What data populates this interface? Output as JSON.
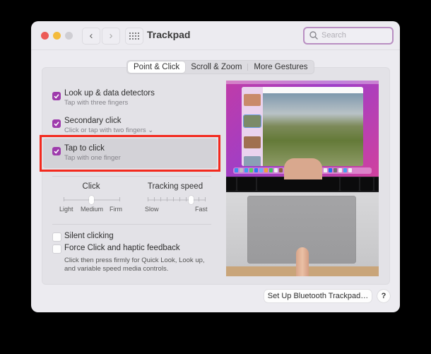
{
  "window": {
    "title": "Trackpad",
    "traffic_lights": [
      "close",
      "minimize",
      "zoom"
    ],
    "nav": {
      "back_icon": "chevron-left-icon",
      "forward_icon": "chevron-right-icon",
      "grid_icon": "show-all-grid-icon"
    },
    "search": {
      "placeholder": "Search",
      "value": ""
    }
  },
  "tabs": [
    {
      "label": "Point & Click",
      "active": true
    },
    {
      "label": "Scroll & Zoom",
      "active": false
    },
    {
      "label": "More Gestures",
      "active": false
    }
  ],
  "options": [
    {
      "title": "Look up & data detectors",
      "subtitle": "Tap with three fingers",
      "checked": true
    },
    {
      "title": "Secondary click",
      "subtitle": "Click or tap with two fingers ⌄",
      "checked": true
    },
    {
      "title": "Tap to click",
      "subtitle": "Tap with one finger",
      "checked": true,
      "highlighted": true
    }
  ],
  "sliders": {
    "click": {
      "label": "Click",
      "tick_labels": [
        "Light",
        "Medium",
        "Firm"
      ],
      "value": "Medium",
      "position_fraction": 0.5
    },
    "tracking": {
      "label": "Tracking speed",
      "tick_labels": [
        "Slow",
        "Fast"
      ],
      "position_fraction": 0.78
    }
  },
  "checkboxes": [
    {
      "label": "Silent clicking",
      "checked": false
    },
    {
      "label": "Force Click and haptic feedback",
      "checked": false
    }
  ],
  "force_click_description": "Click then press firmly for Quick Look, Look up, and variable speed media controls.",
  "preview": {
    "description": "Video preview of a finger tapping a MacBook trackpad"
  },
  "footer": {
    "bluetooth_button": "Set Up Bluetooth Trackpad…",
    "help_button": "?"
  },
  "colors": {
    "accent": "#9e3bac",
    "highlight_box": "#f3291e",
    "search_border": "#b98fc2"
  }
}
